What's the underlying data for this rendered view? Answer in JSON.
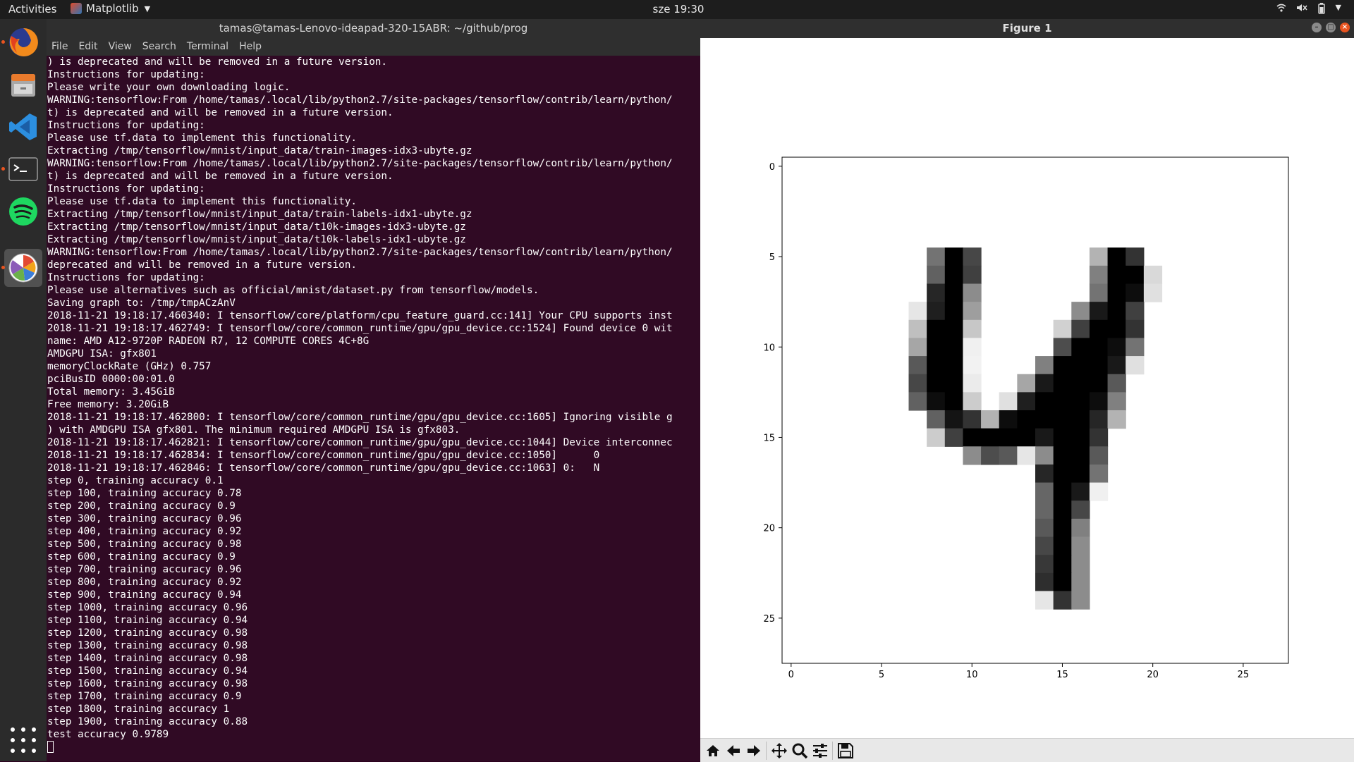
{
  "topbar": {
    "activities": "Activities",
    "app_name": "Matplotlib",
    "clock": "sze 19:30"
  },
  "dock": {
    "items": [
      "firefox",
      "files",
      "vscode",
      "terminal",
      "spotify",
      "matplotlib"
    ],
    "active": "matplotlib"
  },
  "terminal": {
    "title": "tamas@tamas-Lenovo-ideapad-320-15ABR: ~/github/prog",
    "menu": [
      "File",
      "Edit",
      "View",
      "Search",
      "Terminal",
      "Help"
    ],
    "lines": [
      ") is deprecated and will be removed in a future version.",
      "Instructions for updating:",
      "Please write your own downloading logic.",
      "WARNING:tensorflow:From /home/tamas/.local/lib/python2.7/site-packages/tensorflow/contrib/learn/python/",
      "t) is deprecated and will be removed in a future version.",
      "Instructions for updating:",
      "Please use tf.data to implement this functionality.",
      "Extracting /tmp/tensorflow/mnist/input_data/train-images-idx3-ubyte.gz",
      "WARNING:tensorflow:From /home/tamas/.local/lib/python2.7/site-packages/tensorflow/contrib/learn/python/",
      "t) is deprecated and will be removed in a future version.",
      "Instructions for updating:",
      "Please use tf.data to implement this functionality.",
      "Extracting /tmp/tensorflow/mnist/input_data/train-labels-idx1-ubyte.gz",
      "Extracting /tmp/tensorflow/mnist/input_data/t10k-images-idx3-ubyte.gz",
      "Extracting /tmp/tensorflow/mnist/input_data/t10k-labels-idx1-ubyte.gz",
      "WARNING:tensorflow:From /home/tamas/.local/lib/python2.7/site-packages/tensorflow/contrib/learn/python/",
      "deprecated and will be removed in a future version.",
      "Instructions for updating:",
      "Please use alternatives such as official/mnist/dataset.py from tensorflow/models.",
      "Saving graph to: /tmp/tmpACzAnV",
      "2018-11-21 19:18:17.460340: I tensorflow/core/platform/cpu_feature_guard.cc:141] Your CPU supports inst",
      "2018-11-21 19:18:17.462749: I tensorflow/core/common_runtime/gpu/gpu_device.cc:1524] Found device 0 wit",
      "name: AMD A12-9720P RADEON R7, 12 COMPUTE CORES 4C+8G",
      "AMDGPU ISA: gfx801",
      "memoryClockRate (GHz) 0.757",
      "pciBusID 0000:00:01.0",
      "Total memory: 3.45GiB",
      "Free memory: 3.20GiB",
      "2018-11-21 19:18:17.462800: I tensorflow/core/common_runtime/gpu/gpu_device.cc:1605] Ignoring visible g",
      ") with AMDGPU ISA gfx801. The minimum required AMDGPU ISA is gfx803.",
      "2018-11-21 19:18:17.462821: I tensorflow/core/common_runtime/gpu/gpu_device.cc:1044] Device interconnec",
      "2018-11-21 19:18:17.462834: I tensorflow/core/common_runtime/gpu/gpu_device.cc:1050]      0",
      "2018-11-21 19:18:17.462846: I tensorflow/core/common_runtime/gpu/gpu_device.cc:1063] 0:   N",
      "step 0, training accuracy 0.1",
      "step 100, training accuracy 0.78",
      "step 200, training accuracy 0.9",
      "step 300, training accuracy 0.96",
      "step 400, training accuracy 0.92",
      "step 500, training accuracy 0.98",
      "step 600, training accuracy 0.9",
      "step 700, training accuracy 0.96",
      "step 800, training accuracy 0.92",
      "step 900, training accuracy 0.94",
      "step 1000, training accuracy 0.96",
      "step 1100, training accuracy 0.94",
      "step 1200, training accuracy 0.98",
      "step 1300, training accuracy 0.98",
      "step 1400, training accuracy 0.98",
      "step 1500, training accuracy 0.94",
      "step 1600, training accuracy 0.98",
      "step 1700, training accuracy 0.9",
      "step 1800, training accuracy 1",
      "step 1900, training accuracy 0.88",
      "test accuracy 0.9789"
    ],
    "colors": {
      "background": "#300a24",
      "text": "#ffffff"
    }
  },
  "figure": {
    "title": "Figure 1",
    "toolbar": [
      "home-icon",
      "back-icon",
      "forward-icon",
      "pan-icon",
      "zoom-icon",
      "configure-subplots-icon",
      "save-icon"
    ]
  },
  "chart_data": {
    "type": "heatmap",
    "colormap": "gray_r",
    "shape": [
      28,
      28
    ],
    "xlim": [
      -0.5,
      27.5
    ],
    "ylim": [
      27.5,
      -0.5
    ],
    "x_ticks": [
      0,
      5,
      10,
      15,
      20,
      25
    ],
    "y_ticks": [
      0,
      5,
      10,
      15,
      20,
      25
    ],
    "nonzero_pixels": [
      [
        5,
        8,
        0.55
      ],
      [
        5,
        9,
        1.0
      ],
      [
        5,
        10,
        0.72
      ],
      [
        5,
        17,
        0.3
      ],
      [
        5,
        18,
        1.0
      ],
      [
        5,
        19,
        0.8
      ],
      [
        6,
        8,
        0.62
      ],
      [
        6,
        9,
        1.0
      ],
      [
        6,
        10,
        0.75
      ],
      [
        6,
        17,
        0.5
      ],
      [
        6,
        18,
        1.0
      ],
      [
        6,
        19,
        1.0
      ],
      [
        6,
        20,
        0.15
      ],
      [
        7,
        8,
        0.85
      ],
      [
        7,
        9,
        1.0
      ],
      [
        7,
        10,
        0.45
      ],
      [
        7,
        17,
        0.55
      ],
      [
        7,
        18,
        1.0
      ],
      [
        7,
        19,
        0.95
      ],
      [
        7,
        20,
        0.12
      ],
      [
        8,
        7,
        0.1
      ],
      [
        8,
        8,
        0.88
      ],
      [
        8,
        9,
        1.0
      ],
      [
        8,
        10,
        0.38
      ],
      [
        8,
        16,
        0.45
      ],
      [
        8,
        17,
        0.9
      ],
      [
        8,
        18,
        1.0
      ],
      [
        8,
        19,
        0.75
      ],
      [
        9,
        7,
        0.25
      ],
      [
        9,
        8,
        1.0
      ],
      [
        9,
        9,
        1.0
      ],
      [
        9,
        10,
        0.22
      ],
      [
        9,
        15,
        0.18
      ],
      [
        9,
        16,
        0.75
      ],
      [
        9,
        17,
        1.0
      ],
      [
        9,
        18,
        1.0
      ],
      [
        9,
        19,
        0.8
      ],
      [
        10,
        7,
        0.35
      ],
      [
        10,
        8,
        1.0
      ],
      [
        10,
        9,
        1.0
      ],
      [
        10,
        10,
        0.06
      ],
      [
        10,
        15,
        0.7
      ],
      [
        10,
        16,
        1.0
      ],
      [
        10,
        17,
        1.0
      ],
      [
        10,
        18,
        0.95
      ],
      [
        10,
        19,
        0.55
      ],
      [
        11,
        7,
        0.65
      ],
      [
        11,
        8,
        1.0
      ],
      [
        11,
        9,
        1.0
      ],
      [
        11,
        10,
        0.05
      ],
      [
        11,
        14,
        0.5
      ],
      [
        11,
        15,
        1.0
      ],
      [
        11,
        16,
        1.0
      ],
      [
        11,
        17,
        1.0
      ],
      [
        11,
        18,
        0.9
      ],
      [
        11,
        19,
        0.12
      ],
      [
        12,
        7,
        0.72
      ],
      [
        12,
        8,
        1.0
      ],
      [
        12,
        9,
        1.0
      ],
      [
        12,
        10,
        0.08
      ],
      [
        12,
        13,
        0.35
      ],
      [
        12,
        14,
        0.9
      ],
      [
        12,
        15,
        1.0
      ],
      [
        12,
        16,
        1.0
      ],
      [
        12,
        17,
        1.0
      ],
      [
        12,
        18,
        0.65
      ],
      [
        13,
        7,
        0.62
      ],
      [
        13,
        8,
        0.95
      ],
      [
        13,
        9,
        1.0
      ],
      [
        13,
        10,
        0.2
      ],
      [
        13,
        12,
        0.12
      ],
      [
        13,
        13,
        0.88
      ],
      [
        13,
        14,
        1.0
      ],
      [
        13,
        15,
        1.0
      ],
      [
        13,
        16,
        1.0
      ],
      [
        13,
        17,
        0.95
      ],
      [
        13,
        18,
        0.5
      ],
      [
        14,
        8,
        0.62
      ],
      [
        14,
        9,
        0.92
      ],
      [
        14,
        10,
        0.8
      ],
      [
        14,
        11,
        0.3
      ],
      [
        14,
        12,
        0.95
      ],
      [
        14,
        13,
        1.0
      ],
      [
        14,
        14,
        1.0
      ],
      [
        14,
        15,
        1.0
      ],
      [
        14,
        16,
        1.0
      ],
      [
        14,
        17,
        0.85
      ],
      [
        14,
        18,
        0.3
      ],
      [
        15,
        8,
        0.2
      ],
      [
        15,
        9,
        0.75
      ],
      [
        15,
        10,
        1.0
      ],
      [
        15,
        11,
        1.0
      ],
      [
        15,
        12,
        1.0
      ],
      [
        15,
        13,
        1.0
      ],
      [
        15,
        14,
        0.9
      ],
      [
        15,
        15,
        1.0
      ],
      [
        15,
        16,
        1.0
      ],
      [
        15,
        17,
        0.8
      ],
      [
        16,
        10,
        0.45
      ],
      [
        16,
        11,
        0.7
      ],
      [
        16,
        12,
        0.65
      ],
      [
        16,
        13,
        0.1
      ],
      [
        16,
        14,
        0.45
      ],
      [
        16,
        15,
        1.0
      ],
      [
        16,
        16,
        1.0
      ],
      [
        16,
        17,
        0.65
      ],
      [
        17,
        14,
        0.85
      ],
      [
        17,
        15,
        1.0
      ],
      [
        17,
        16,
        1.0
      ],
      [
        17,
        17,
        0.55
      ],
      [
        18,
        14,
        0.6
      ],
      [
        18,
        15,
        1.0
      ],
      [
        18,
        16,
        0.9
      ],
      [
        18,
        17,
        0.06
      ],
      [
        19,
        14,
        0.6
      ],
      [
        19,
        15,
        1.0
      ],
      [
        19,
        16,
        0.72
      ],
      [
        20,
        14,
        0.65
      ],
      [
        20,
        15,
        1.0
      ],
      [
        20,
        16,
        0.5
      ],
      [
        21,
        14,
        0.72
      ],
      [
        21,
        15,
        1.0
      ],
      [
        21,
        16,
        0.45
      ],
      [
        22,
        14,
        0.78
      ],
      [
        22,
        15,
        1.0
      ],
      [
        22,
        16,
        0.45
      ],
      [
        23,
        14,
        0.82
      ],
      [
        23,
        15,
        1.0
      ],
      [
        23,
        16,
        0.45
      ],
      [
        24,
        14,
        0.1
      ],
      [
        24,
        15,
        0.8
      ],
      [
        24,
        16,
        0.45
      ]
    ]
  }
}
